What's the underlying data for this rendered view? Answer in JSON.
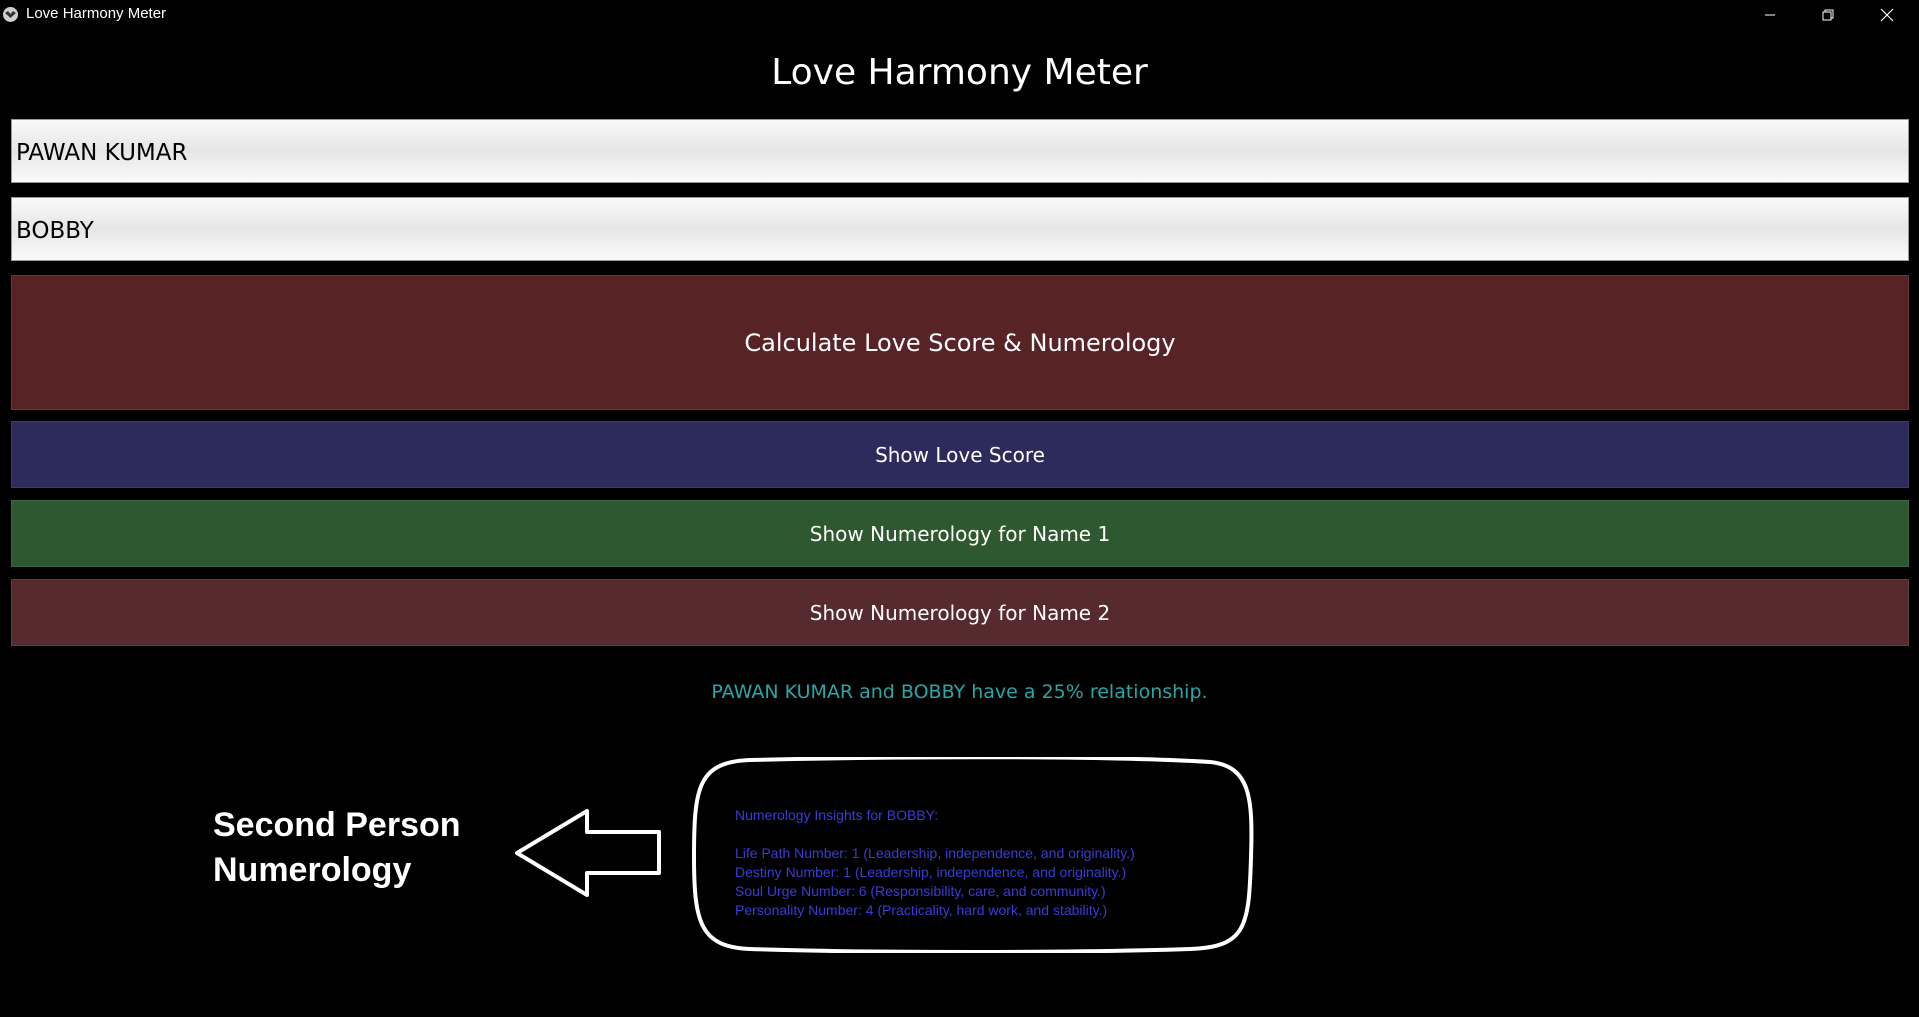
{
  "window": {
    "title": "Love Harmony Meter",
    "icon": "app-logo-icon",
    "controls": [
      "minimize-icon",
      "restore-icon",
      "close-icon"
    ]
  },
  "app": {
    "heading": "Love Harmony Meter"
  },
  "inputs": {
    "name1": "PAWAN KUMAR",
    "name2": "BOBBY"
  },
  "buttons": {
    "calculate": "Calculate Love Score & Numerology",
    "show_score": "Show Love Score",
    "show_numerology_1": "Show Numerology for Name 1",
    "show_numerology_2": "Show Numerology for Name 2"
  },
  "result": {
    "text": "PAWAN KUMAR and BOBBY have a 25% relationship."
  },
  "annotation": {
    "label": "Second Person\nNumerology",
    "arrow_icon": "left-arrow-icon"
  },
  "insights": {
    "heading": "Numerology Insights for BOBBY:",
    "lines": [
      "Life Path Number: 1 (Leadership, independence, and originality.)",
      "Destiny Number: 1 (Leadership, independence, and originality.)",
      "Soul Urge Number: 6 (Responsibility, care, and community.)",
      "Personality Number: 4 (Practicality, hard work, and stability.)"
    ]
  },
  "colors": {
    "background": "#000000",
    "calculate_button": "#572325",
    "score_button": "#2d2b5c",
    "numerology1_button": "#2e582f",
    "numerology2_button": "#572b2d",
    "result_text": "#2aa6a6",
    "insights_text": "#3b3bd6"
  }
}
